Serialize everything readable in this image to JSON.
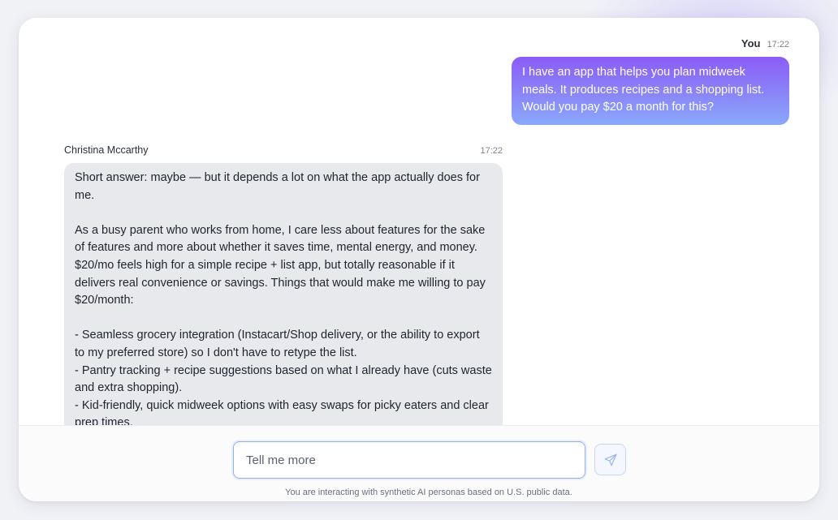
{
  "chat": {
    "user_message": {
      "author": "You",
      "time": "17:22",
      "text": "I have an app that helps you plan midweek meals. It produces recipes and a shopping list. Would you pay $20 a month for this?"
    },
    "persona_message": {
      "author": "Christina Mccarthy",
      "time": "17:22",
      "paragraph1": "Short answer: maybe — but it depends a lot on what the app actually does for me.",
      "paragraph2": "As a busy parent who works from home, I care less about features for the sake of features and more about whether it saves time, mental energy, and money. $20/mo feels high for a simple recipe + list app, but totally reasonable if it delivers real convenience or savings. Things that would make me willing to pay $20/month:",
      "bullet1": "- Seamless grocery integration (Instacart/Shop delivery, or the ability to export to my preferred store) so I don't have to retype the list.",
      "bullet2": "- Pantry tracking + recipe suggestions based on what I already have (cuts waste and extra shopping).",
      "bullet3": "- Kid-friendly, quick midweek options with easy swaps for picky eaters and clear prep times."
    }
  },
  "composer": {
    "placeholder": "Tell me more",
    "value": "",
    "send_icon": "paper-plane-icon"
  },
  "footer": {
    "disclaimer": "You are interacting with synthetic AI personas based on U.S. public data."
  },
  "colors": {
    "user_bubble_top": "#8b5cf6",
    "user_bubble_bottom": "#8aa8fa",
    "persona_bubble": "#e8e9ec",
    "input_border": "#8fb3ef"
  }
}
